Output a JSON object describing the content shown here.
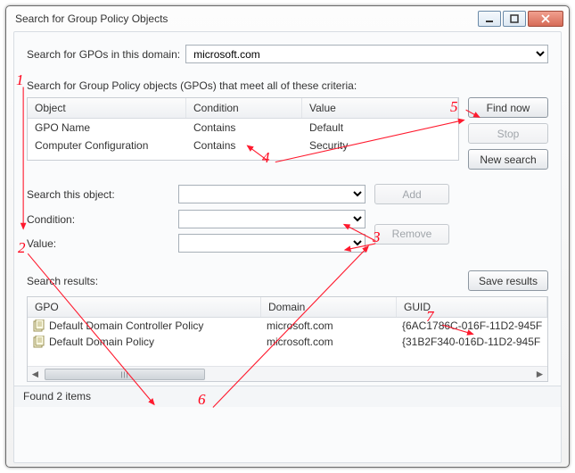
{
  "window": {
    "title": "Search for Group Policy Objects"
  },
  "domain": {
    "label": "Search for GPOs in this domain:",
    "value": "microsoft.com"
  },
  "criteria": {
    "header": "Search for Group Policy objects (GPOs) that meet all of these criteria:",
    "columns": {
      "object": "Object",
      "condition": "Condition",
      "value": "Value"
    },
    "rows": [
      {
        "object": "GPO Name",
        "condition": "Contains",
        "value": "Default"
      },
      {
        "object": "Computer Configuration",
        "condition": "Contains",
        "value": "Security"
      }
    ]
  },
  "buttons": {
    "find_now": "Find now",
    "stop": "Stop",
    "new_search": "New search",
    "add": "Add",
    "remove": "Remove",
    "save_results": "Save results"
  },
  "form": {
    "search_object_label": "Search this object:",
    "condition_label": "Condition:",
    "value_label": "Value:",
    "search_object_value": "",
    "condition_value": "",
    "value_value": ""
  },
  "results": {
    "label": "Search results:",
    "columns": {
      "gpo": "GPO",
      "domain": "Domain",
      "guid": "GUID"
    },
    "rows": [
      {
        "gpo": "Default Domain Controller Policy",
        "domain": "microsoft.com",
        "guid": "{6AC1786C-016F-11D2-945F"
      },
      {
        "gpo": "Default Domain Policy",
        "domain": "microsoft.com",
        "guid": "{31B2F340-016D-11D2-945F"
      }
    ]
  },
  "status": "Found 2 items",
  "annotations": {
    "1": "1",
    "2": "2",
    "3": "3",
    "4": "4",
    "5": "5",
    "6": "6",
    "7": "7"
  }
}
